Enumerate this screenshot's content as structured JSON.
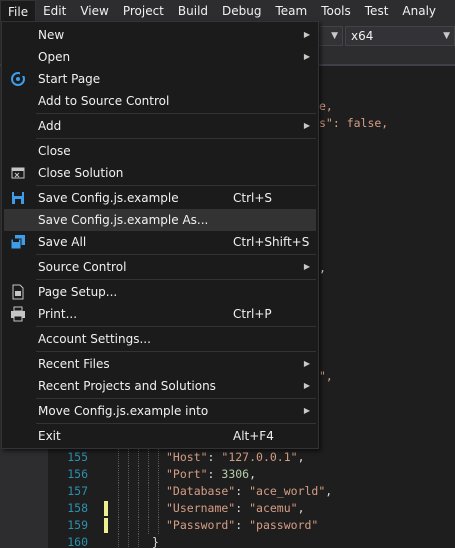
{
  "menubar": {
    "items": [
      "File",
      "Edit",
      "View",
      "Project",
      "Build",
      "Debug",
      "Team",
      "Tools",
      "Test",
      "Analy"
    ]
  },
  "toolbar": {
    "platform_combo": "x64"
  },
  "editor": {
    "partial_lines": [
      {
        "text": "e,",
        "color": "#d69d85"
      },
      {
        "text": "s\": false,",
        "color": "#d69d85"
      },
      {
        "text": ",",
        "color": "#dcdcdc"
      },
      {
        "text": "\",",
        "color": "#d69d85"
      }
    ],
    "lines": [
      {
        "num": "155",
        "key": "\"Host\"",
        "sep": ": ",
        "value": "\"127.0.0.1\"",
        "end": ",",
        "value_type": "string",
        "changed": false
      },
      {
        "num": "156",
        "key": "\"Port\"",
        "sep": ": ",
        "value": "3306",
        "end": ",",
        "value_type": "number",
        "changed": false
      },
      {
        "num": "157",
        "key": "\"Database\"",
        "sep": ": ",
        "value": "\"ace_world\"",
        "end": ",",
        "value_type": "string",
        "changed": false
      },
      {
        "num": "158",
        "key": "\"Username\"",
        "sep": ": ",
        "value": "\"acemu\"",
        "end": ",",
        "value_type": "string",
        "changed": true
      },
      {
        "num": "159",
        "key": "\"Password\"",
        "sep": ": ",
        "value": "\"password\"",
        "end": "",
        "value_type": "string",
        "changed": true
      },
      {
        "num": "160",
        "key": "}",
        "sep": "",
        "value": "",
        "end": "",
        "value_type": "brace",
        "changed": false
      }
    ]
  },
  "file_menu": {
    "new": "New",
    "open": "Open",
    "start_page": "Start Page",
    "add_to_source_control": "Add to Source Control",
    "add": "Add",
    "close": "Close",
    "close_solution": "Close Solution",
    "save": "Save Config.js.example",
    "save_shortcut": "Ctrl+S",
    "save_as": "Save Config.js.example As...",
    "save_all": "Save All",
    "save_all_shortcut": "Ctrl+Shift+S",
    "source_control": "Source Control",
    "page_setup": "Page Setup...",
    "print": "Print...",
    "print_shortcut": "Ctrl+P",
    "account_settings": "Account Settings...",
    "recent_files": "Recent Files",
    "recent_projects": "Recent Projects and Solutions",
    "move_into": "Move Config.js.example into",
    "exit": "Exit",
    "exit_shortcut": "Alt+F4"
  },
  "colors": {
    "accent_blue": "#569cd6",
    "string": "#d69d85",
    "number": "#b5cea8",
    "line_number": "#2b91af",
    "change_marker": "#efef91"
  }
}
